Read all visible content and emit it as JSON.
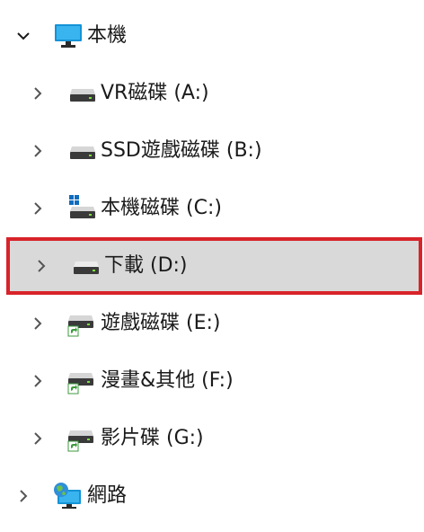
{
  "tree": {
    "this_pc": {
      "label": "本機",
      "expanded": true
    },
    "drives": [
      {
        "label": "VR磁碟 (A:)",
        "icon": "drive-icon"
      },
      {
        "label": "SSD遊戲磁碟 (B:)",
        "icon": "drive-icon"
      },
      {
        "label": "本機磁碟 (C:)",
        "icon": "windows-drive-icon"
      },
      {
        "label": "下載 (D:)",
        "icon": "drive-icon",
        "selected": true
      },
      {
        "label": "遊戲磁碟 (E:)",
        "icon": "shared-drive-icon"
      },
      {
        "label": "漫畫&其他 (F:)",
        "icon": "shared-drive-icon"
      },
      {
        "label": "影片碟 (G:)",
        "icon": "shared-drive-icon"
      }
    ],
    "network": {
      "label": "網路",
      "expanded": false
    }
  },
  "colors": {
    "selection_bg": "#d9d9d9",
    "selection_border": "#d8232a",
    "shortcut_green": "#3c9a3c",
    "windows_blue": "#0f6cbd"
  }
}
